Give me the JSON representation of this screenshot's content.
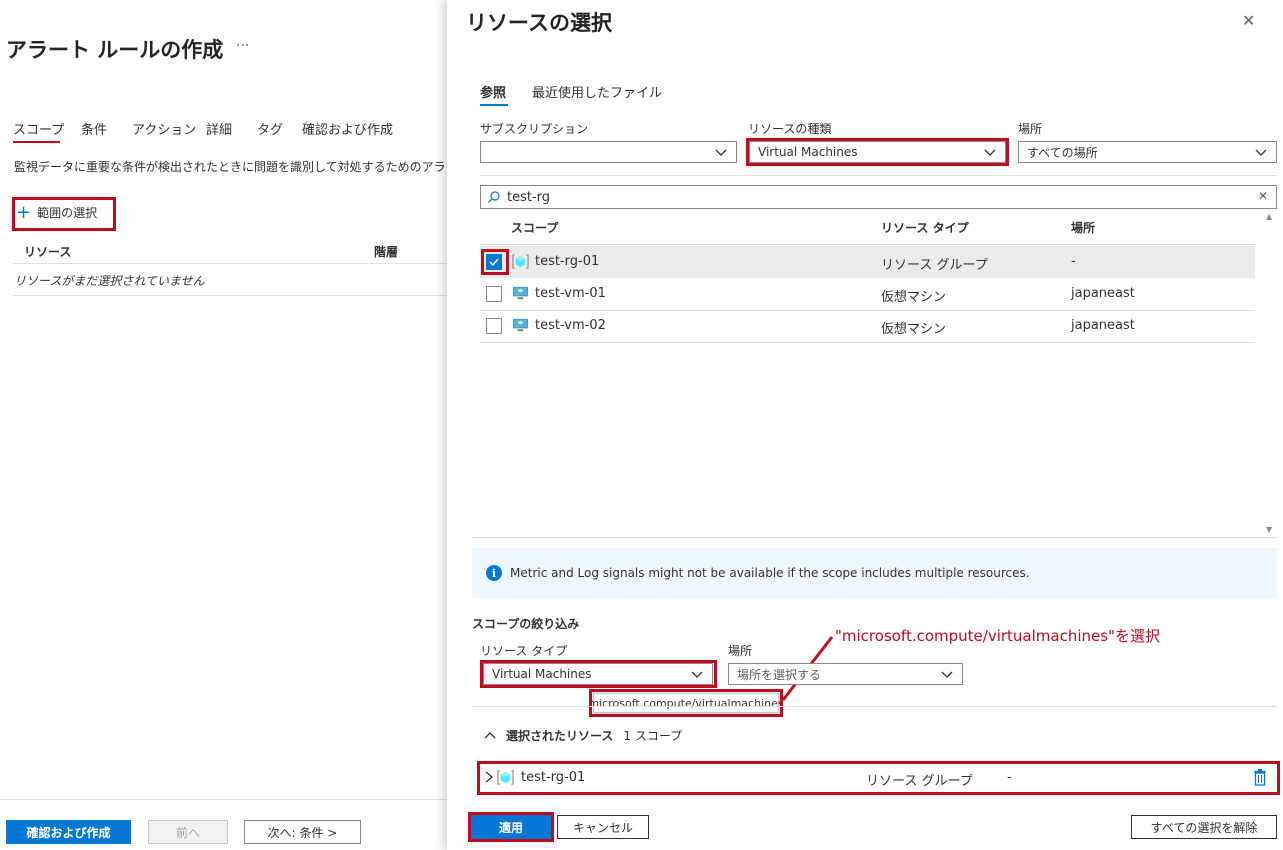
{
  "left": {
    "title": "アラート ルールの作成",
    "more": "···",
    "tabs": [
      "スコープ",
      "条件",
      "アクション",
      "詳細",
      "タグ",
      "確認および作成"
    ],
    "description": "監視データに重要な条件が検出されたときに問題を識別して対処するためのアラート ル",
    "add_scope": "範囲の選択",
    "columns": [
      "リソース",
      "階層"
    ],
    "empty_text": "リソースがまだ選択されていません",
    "buttons": {
      "review": "確認および作成",
      "prev": "前へ",
      "next": "次へ: 条件 >"
    }
  },
  "panel": {
    "title": "リソースの選択",
    "close": "✕",
    "tabs": [
      "参照",
      "最近使用したファイル"
    ],
    "subscription_label": "サブスクリプション",
    "subscription_value": "",
    "resource_type_label": "リソースの種類",
    "resource_type_value": "Virtual Machines",
    "location_label": "場所",
    "location_value": "すべての場所",
    "search_value": "test-rg",
    "table_headers": [
      "スコープ",
      "リソース タイプ",
      "場所"
    ],
    "rows": [
      {
        "name": "test-rg-01",
        "type": "リソース グループ",
        "location": "-",
        "checked": true
      },
      {
        "name": "test-vm-01",
        "type": "仮想マシン",
        "location": "japaneast",
        "checked": false
      },
      {
        "name": "test-vm-02",
        "type": "仮想マシン",
        "location": "japaneast",
        "checked": false
      }
    ],
    "info": "Metric and Log signals might not be available if the scope includes multiple resources.",
    "filter_title": "スコープの絞り込み",
    "filter_type_label": "リソース タイプ",
    "filter_type_value": "Virtual Machines",
    "filter_loc_label": "場所",
    "filter_loc_placeholder": "場所を選択する",
    "tooltip": "microsoft.compute/virtualmachines",
    "annotation": "\"microsoft.compute/virtualmachines\"を選択",
    "selected_title": "選択されたリソース",
    "selected_count": "1 スコープ",
    "selected_row": {
      "name": "test-rg-01",
      "type": "リソース グループ",
      "location": "-"
    },
    "buttons": {
      "apply": "適用",
      "cancel": "キャンセル",
      "clear": "すべての選択を解除"
    }
  },
  "colors": {
    "accent": "#0078d4",
    "highlight": "#c00a1e"
  }
}
